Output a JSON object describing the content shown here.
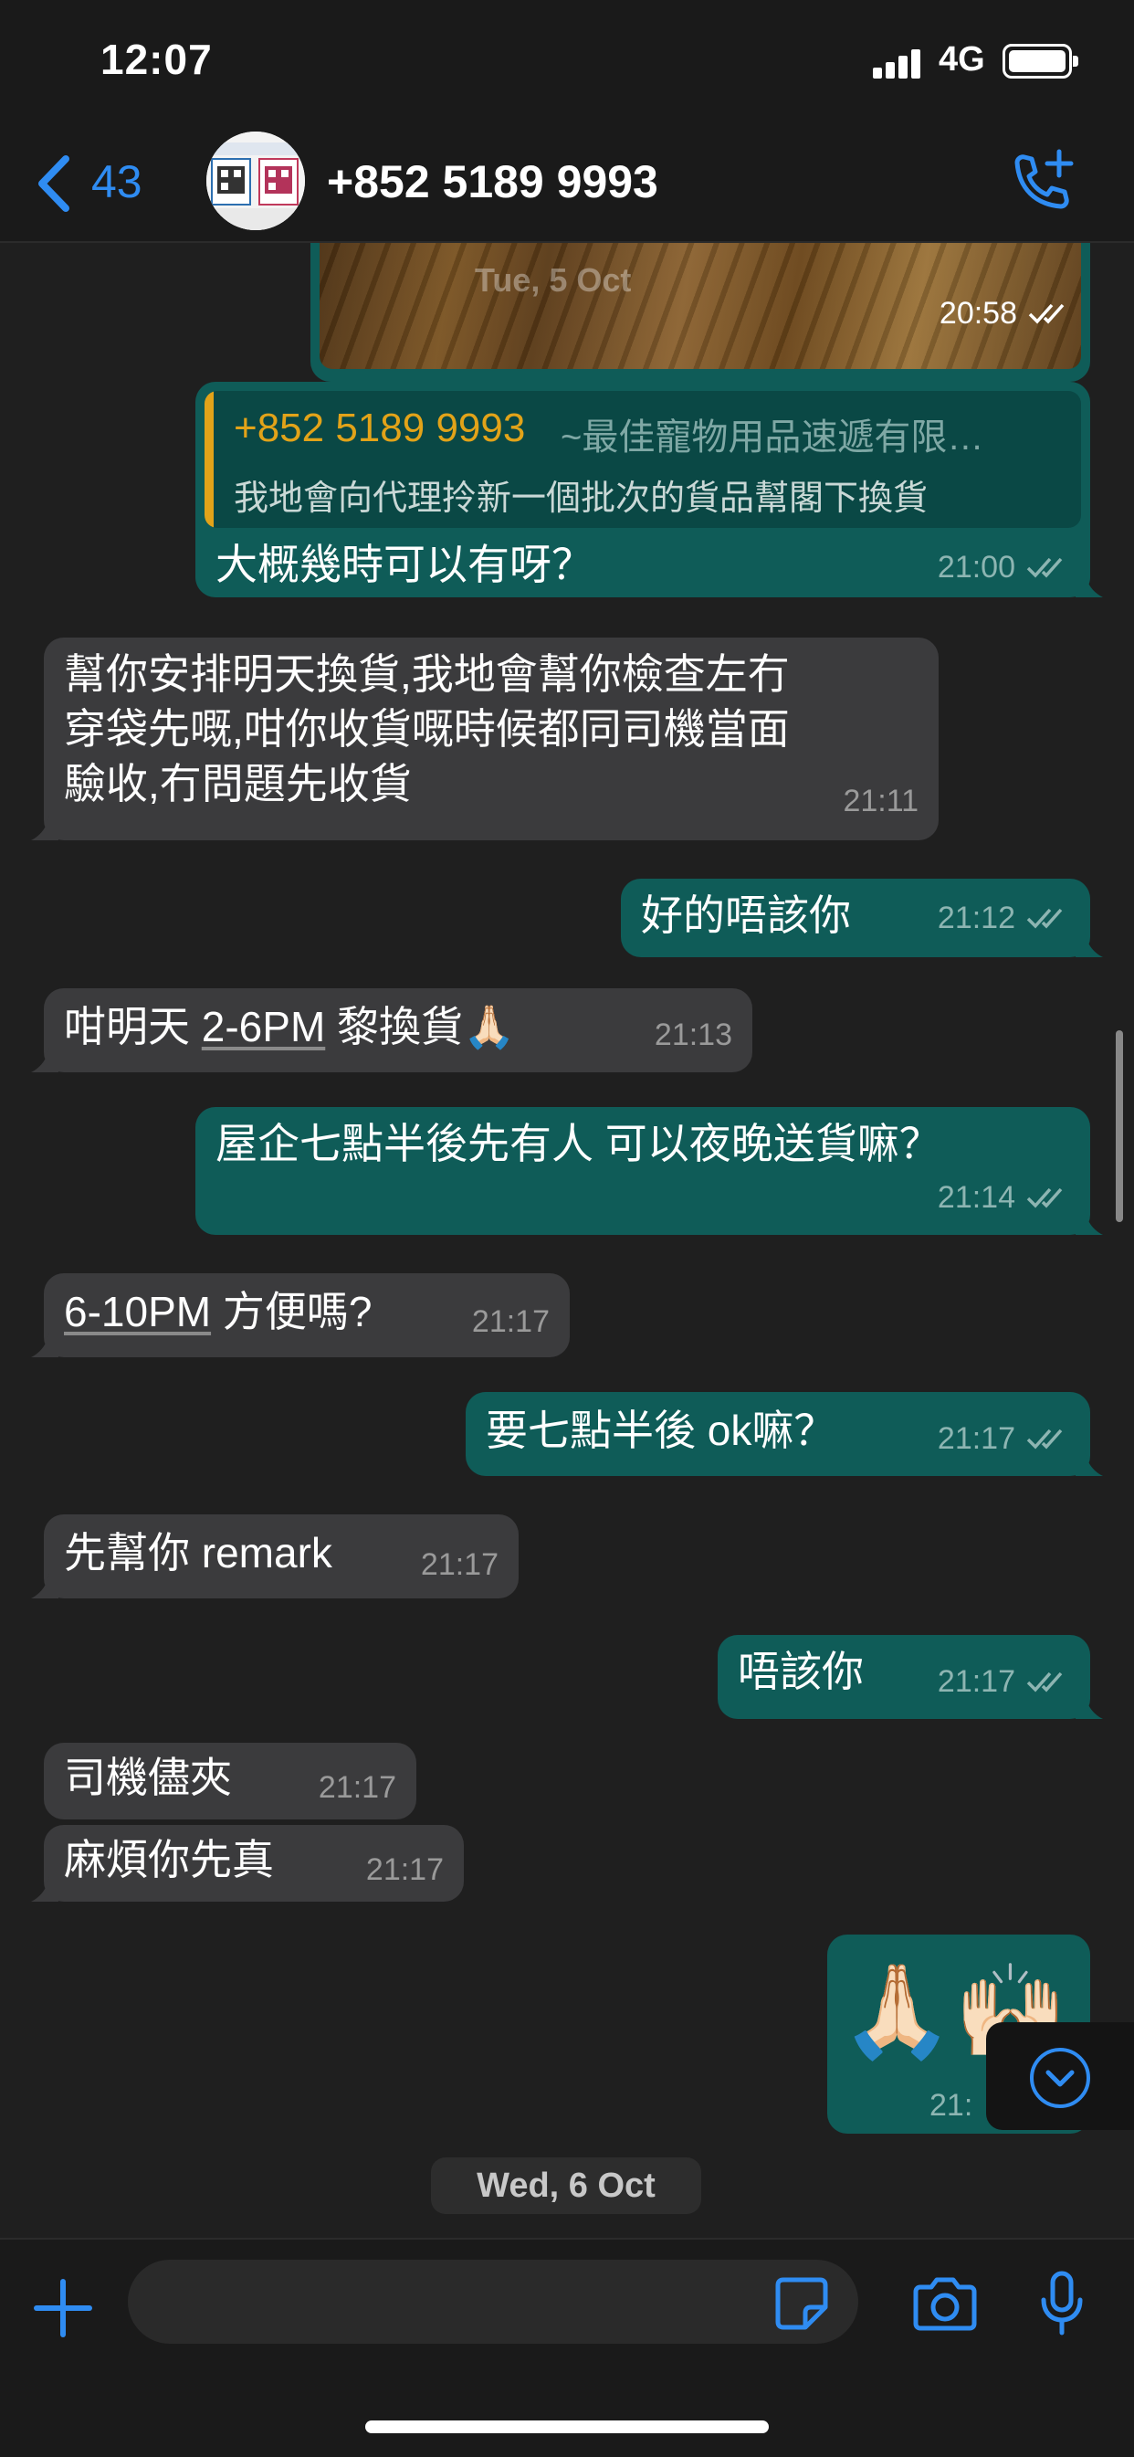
{
  "status_bar": {
    "time": "12:07",
    "network": "4G"
  },
  "header": {
    "back_count": "43",
    "contact_name": "+852 5189 9993"
  },
  "photo": {
    "date_overlay": "Tue, 5 Oct",
    "time": "20:58"
  },
  "quote": {
    "name": "+852 5189 9993",
    "tag": "~最佳寵物用品速遞有限…",
    "text": "我地會向代理拎新一個批次的貨品幫閣下換貨"
  },
  "messages": [
    {
      "dir": "out",
      "text": "大概幾時可以有呀？",
      "time": "21:00"
    },
    {
      "dir": "in",
      "lines": [
        "幫你安排明天換貨,我地會幫你檢查左冇",
        "穿袋先嘅,咁你收貨嘅時候都同司機當面",
        "驗收,冇問題先收貨"
      ],
      "time": "21:11"
    },
    {
      "dir": "out",
      "text": "好的唔該你",
      "time": "21:12"
    },
    {
      "dir": "in",
      "text_pre": "咁明天 ",
      "text_link": "2-6PM",
      "text_post": " 黎換貨🙏🏻",
      "time": "21:13"
    },
    {
      "dir": "out",
      "text": "屋企七點半後先有人 可以夜晚送貨嘛？",
      "time": "21:14"
    },
    {
      "dir": "in",
      "text_link": "6-10PM",
      "text_post": " 方便嗎?",
      "time": "21:17"
    },
    {
      "dir": "out",
      "text": "要七點半後 ok嘛？",
      "time": "21:17"
    },
    {
      "dir": "in",
      "text": "先幫你 remark",
      "time": "21:17"
    },
    {
      "dir": "out",
      "text": "唔該你",
      "time": "21:17"
    },
    {
      "dir": "in",
      "text": "司機儘夾",
      "time": "21:17"
    },
    {
      "dir": "in",
      "text": "麻煩你先真",
      "time": "21:17"
    },
    {
      "dir": "out",
      "emoji": "🙏🏻🙌🏻",
      "time": "21:"
    }
  ],
  "date_separator": "Wed, 6 Oct",
  "icons": {
    "back": "chevron-left-icon",
    "call": "add-call-icon",
    "plus": "plus-icon",
    "sticker": "sticker-icon",
    "camera": "camera-icon",
    "mic": "microphone-icon",
    "scroll": "chevron-down-circle-icon",
    "ticks": "double-check-icon"
  },
  "colors": {
    "accent": "#2f8cf2",
    "outgoing_bubble": "#0f5c58",
    "incoming_bubble": "#3b3b3d",
    "quote_name": "#e2a319",
    "background": "#1f1f1f"
  }
}
